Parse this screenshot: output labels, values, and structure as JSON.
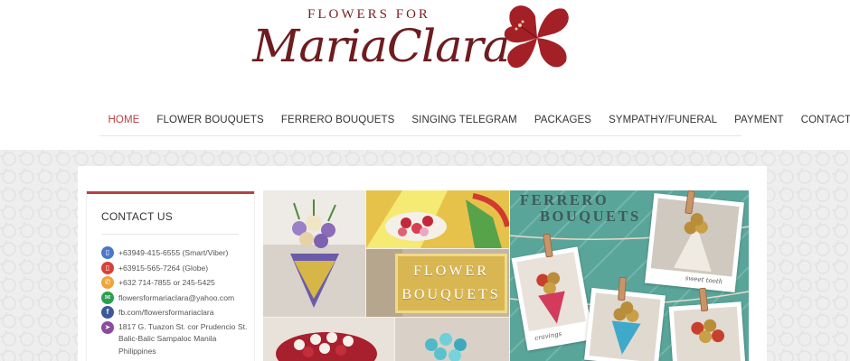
{
  "logo": {
    "top_text": "FLOWERS FOR",
    "main_text": "MariaClara",
    "brand_color": "#6e1c1f",
    "icon": "hibiscus-flower-icon"
  },
  "nav": {
    "active_color": "#b84142",
    "items": [
      {
        "label": "HOME",
        "active": true
      },
      {
        "label": "FLOWER BOUQUETS",
        "active": false
      },
      {
        "label": "FERRERO BOUQUETS",
        "active": false
      },
      {
        "label": "SINGING TELEGRAM",
        "active": false
      },
      {
        "label": "PACKAGES",
        "active": false
      },
      {
        "label": "SYMPATHY/FUNERAL",
        "active": false
      },
      {
        "label": "PAYMENT",
        "active": false
      },
      {
        "label": "CONTACT US",
        "active": false
      }
    ]
  },
  "sidebar": {
    "title": "CONTACT US",
    "accent_color": "#b84142",
    "contacts": [
      {
        "icon": "mobile-phone-icon",
        "color": "#4b78c9",
        "text": "+63949-415-6555 (Smart/Viber)"
      },
      {
        "icon": "mobile-phone-icon",
        "color": "#d9403a",
        "text": "+63915-565-7264 (Globe)"
      },
      {
        "icon": "phone-icon",
        "color": "#f0a43a",
        "text": "+632 714-7855 or 245-5425"
      },
      {
        "icon": "envelope-icon",
        "color": "#2e9e4f",
        "text": "flowersformariaclara@yahoo.com"
      },
      {
        "icon": "facebook-icon",
        "color": "#3b5998",
        "text": "fb.com/flowersformariaclara"
      },
      {
        "icon": "location-arrow-icon",
        "color": "#8b4b9e",
        "text": "1817 G. Tuazon St. cor Prudencio St. Balic-Balic Sampaloc Manila Philippines"
      }
    ]
  },
  "hero": {
    "flower_bouquets_line1": "FLOWER",
    "flower_bouquets_line2": "BOUQUETS",
    "ferrero_line1": "FERRERO",
    "ferrero_line2": "BOUQUETS",
    "caption_sweet": "sweet tooth",
    "caption_cravings": "cravings"
  }
}
